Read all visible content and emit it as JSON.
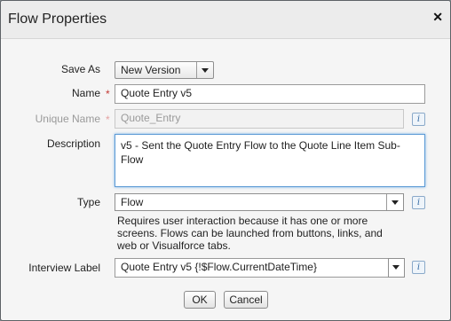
{
  "dialog": {
    "title": "Flow Properties",
    "close_glyph": "✕"
  },
  "form": {
    "save_as": {
      "label": "Save As",
      "value": "New Version"
    },
    "name": {
      "label": "Name",
      "required_mark": "*",
      "value": "Quote Entry v5"
    },
    "unique_name": {
      "label": "Unique Name",
      "required_mark": "*",
      "value": "Quote_Entry",
      "info_glyph": "i"
    },
    "description": {
      "label": "Description",
      "value": "v5 - Sent the Quote Entry Flow to the Quote Line Item Sub-Flow"
    },
    "type": {
      "label": "Type",
      "value": "Flow",
      "info_glyph": "i",
      "help": "Requires user interaction because it has one or more screens. Flows can be launched from buttons, links, and web or Visualforce tabs."
    },
    "interview_label": {
      "label": "Interview Label",
      "value": "Quote Entry v5 {!$Flow.CurrentDateTime}",
      "info_glyph": "i"
    }
  },
  "buttons": {
    "ok": "OK",
    "cancel": "Cancel"
  },
  "colors": {
    "required": "#c23934",
    "focus_border": "#5b9ad5",
    "backdrop": "#7d8489"
  }
}
